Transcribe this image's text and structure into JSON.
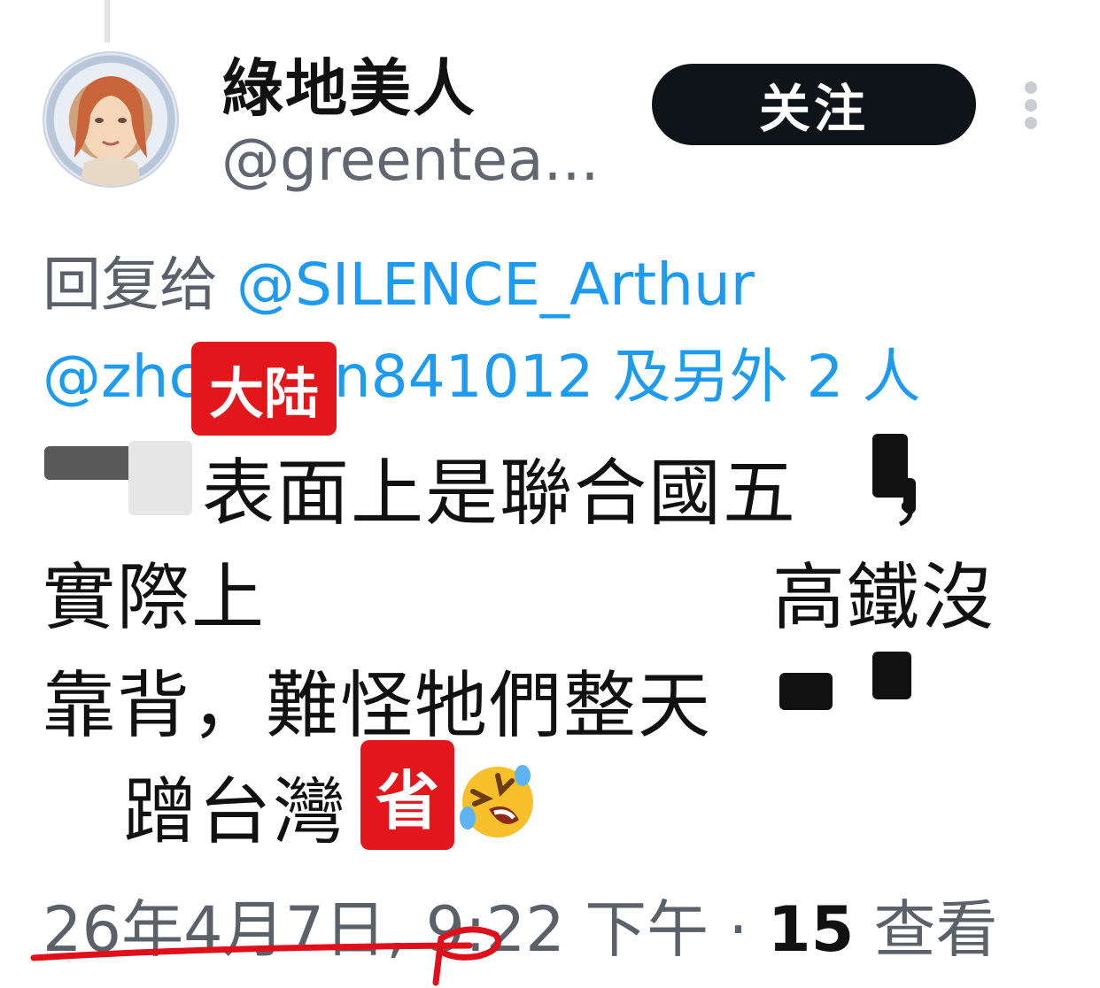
{
  "profile": {
    "display_name": "綠地美人",
    "handle": "@greentea..."
  },
  "follow_button": {
    "label": "关注"
  },
  "reply": {
    "prefix": "回复给",
    "user1": "@SILENCE_Arthur",
    "user2": "@zhc",
    "user2_tail": "n841012",
    "others": "及另外 2 人"
  },
  "annotations": {
    "tag1": "大陆",
    "tag2": "省"
  },
  "tweet": {
    "line1": "表面上是聯合國五",
    "line1_tail": "，",
    "line2": "實際上",
    "line2_tail": "高鐵沒",
    "line3": "靠背，難怪牠們整天",
    "line4": "蹭台灣"
  },
  "meta": {
    "timestamp": "26年4月7日, 9:22 下午",
    "separator": " · ",
    "views_count": "15",
    "views_label": " 查看"
  },
  "icons": {
    "emoji": "rolling-on-floor-laughing-emoji",
    "more": "more-vertical-icon",
    "avatar": "avatar"
  },
  "colors": {
    "link_blue": "#1d9bf0",
    "button_bg": "#0f1419",
    "tag_red": "#e3161b",
    "marker_red": "#e0101a"
  }
}
